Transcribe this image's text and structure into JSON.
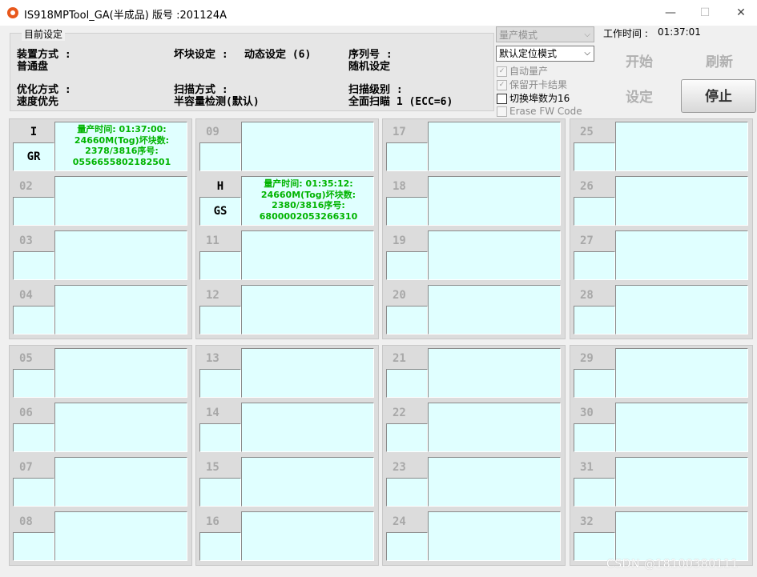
{
  "window": {
    "title": "IS918MPTool_GA(半成品) 版号 :201124A",
    "minimize": "—",
    "maximize": "☐",
    "close": "✕"
  },
  "settings": {
    "legend": "目前设定",
    "device_mode_label": "装置方式 :",
    "device_mode_value": "普通盘",
    "bad_block_label": "坏块设定 :",
    "bad_block_value": "动态设定 (6)",
    "serial_label": "序列号 :",
    "serial_value": "随机设定",
    "optimize_label": "优化方式 :",
    "optimize_value": "速度优先",
    "scan_mode_label": "扫描方式 :",
    "scan_mode_value": "半容量检测(默认)",
    "scan_level_label": "扫描级别 :",
    "scan_level_value": "全面扫瞄 1 (ECC=6)"
  },
  "controls": {
    "mode_select": "量产模式",
    "position_select": "默认定位模式",
    "auto_mp": "自动量产",
    "keep_result": "保留开卡结果",
    "switch_16": "切换埠数为16",
    "erase_fw": "Erase FW Code",
    "worktime_label": "工作时间 :",
    "worktime_value": "01:37:01",
    "start": "开始",
    "refresh": "刷新",
    "setup": "设定",
    "stop": "停止"
  },
  "ports": [
    {
      "num": "I",
      "code": "GR",
      "info": [
        "量产时间: 01:37:00:",
        "24660M(Tog)坏块数:",
        "2378/3816序号:",
        "0556655802182501"
      ]
    },
    {
      "num": "02"
    },
    {
      "num": "03"
    },
    {
      "num": "04"
    },
    {
      "num": "05"
    },
    {
      "num": "06"
    },
    {
      "num": "07"
    },
    {
      "num": "08"
    },
    {
      "num": "09"
    },
    {
      "num": "H",
      "code": "GS",
      "info": [
        "量产时间: 01:35:12:",
        "24660M(Tog)坏块数:",
        "2380/3816序号:",
        "6800002053266310"
      ]
    },
    {
      "num": "11"
    },
    {
      "num": "12"
    },
    {
      "num": "13"
    },
    {
      "num": "14"
    },
    {
      "num": "15"
    },
    {
      "num": "16"
    },
    {
      "num": "17"
    },
    {
      "num": "18"
    },
    {
      "num": "19"
    },
    {
      "num": "20"
    },
    {
      "num": "21"
    },
    {
      "num": "22"
    },
    {
      "num": "23"
    },
    {
      "num": "24"
    },
    {
      "num": "25"
    },
    {
      "num": "26"
    },
    {
      "num": "27"
    },
    {
      "num": "28"
    },
    {
      "num": "29"
    },
    {
      "num": "30"
    },
    {
      "num": "31"
    },
    {
      "num": "32"
    }
  ],
  "watermark": "CSDN @18100380111"
}
